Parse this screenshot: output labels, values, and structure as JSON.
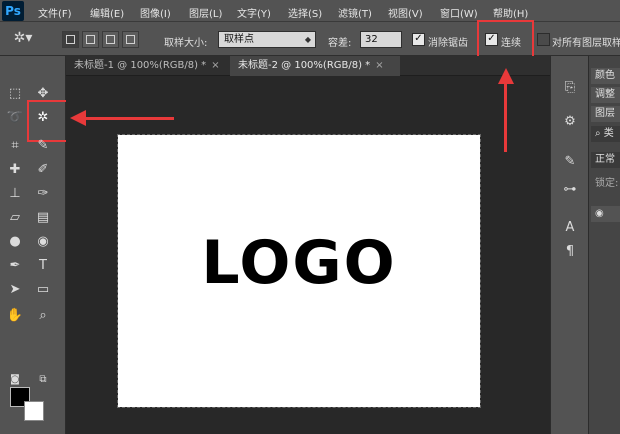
{
  "app": {
    "logo": "Ps"
  },
  "menu": [
    "文件(F)",
    "编辑(E)",
    "图像(I)",
    "图层(L)",
    "文字(Y)",
    "选择(S)",
    "滤镜(T)",
    "视图(V)",
    "窗口(W)",
    "帮助(H)"
  ],
  "options": {
    "sample_size_label": "取样大小:",
    "sample_size_value": "取样点",
    "tolerance_label": "容差:",
    "tolerance_value": "32",
    "antialias_label": "消除锯齿",
    "contiguous_label": "连续",
    "all_layers_label": "对所有图层取样"
  },
  "tabs": [
    {
      "label": "未标题-1 @ 100%(RGB/8) *"
    },
    {
      "label": "未标题-2 @ 100%(RGB/8) *"
    }
  ],
  "canvas": {
    "logo_text": "LOGO"
  },
  "panels": {
    "color": "颜色",
    "adjust": "调整",
    "layers": "图层",
    "kind": "类",
    "normal": "正常",
    "lock": "锁定:"
  },
  "colors": {
    "highlight": "#e8393a",
    "foreground": "#000000",
    "background": "#ffffff"
  },
  "icons": [
    "magic-wand-icon",
    "marquee-icon",
    "lasso-icon",
    "crop-icon",
    "eyedropper-icon",
    "brush-icon",
    "eraser-icon",
    "pen-icon",
    "text-icon",
    "hand-icon",
    "zoom-icon"
  ]
}
